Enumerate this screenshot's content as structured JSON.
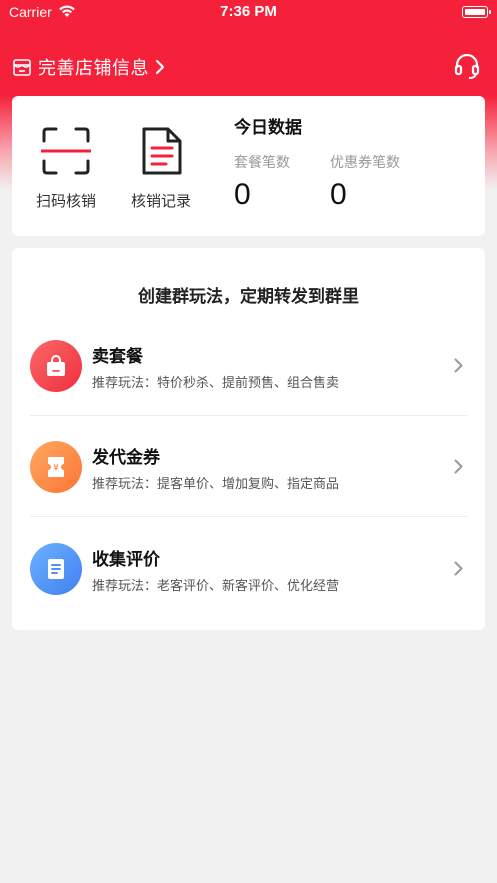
{
  "status_bar": {
    "carrier": "Carrier",
    "time": "7:36 PM"
  },
  "header": {
    "store_link_label": "完善店铺信息"
  },
  "tools": {
    "scan_label": "扫码核销",
    "record_label": "核销记录"
  },
  "today": {
    "title": "今日数据",
    "stats": [
      {
        "label": "套餐笔数",
        "value": "0"
      },
      {
        "label": "优惠券笔数",
        "value": "0"
      }
    ]
  },
  "plays": {
    "title": "创建群玩法，定期转发到群里",
    "items": [
      {
        "name": "卖套餐",
        "desc": "推荐玩法：特价秒杀、提前预售、组合售卖",
        "icon": "shopping-bag-icon"
      },
      {
        "name": "发代金券",
        "desc": "推荐玩法：提客单价、增加复购、指定商品",
        "icon": "coupon-icon"
      },
      {
        "name": "收集评价",
        "desc": "推荐玩法：老客评价、新客评价、优化经营",
        "icon": "document-icon"
      }
    ]
  },
  "colors": {
    "brand_red": "#f5213a",
    "orange": "#fb7536",
    "blue": "#3f7ff0",
    "background": "#f1f1f1"
  }
}
